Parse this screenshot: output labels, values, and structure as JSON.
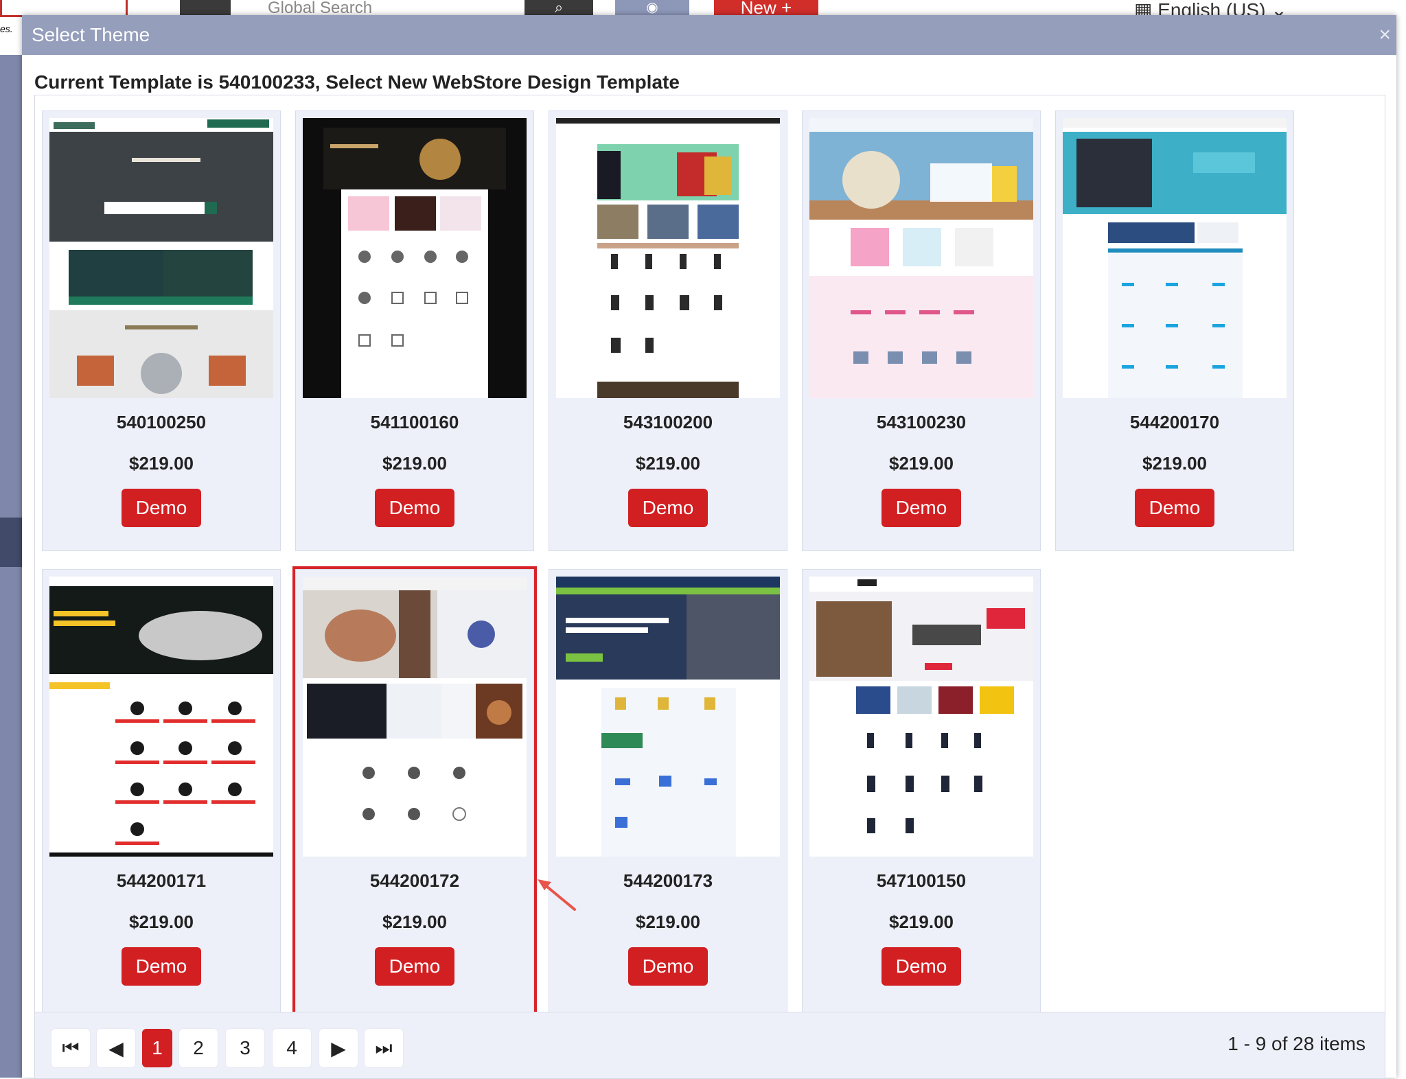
{
  "background": {
    "search_placeholder": "Global Search",
    "new_label": "New +",
    "language": "English (US)",
    "side_text": "es."
  },
  "modal": {
    "title": "Select Theme",
    "close_glyph": "×",
    "subtitle": "Current Template is 540100233, Select New WebStore Design Template"
  },
  "templates": [
    {
      "code": "540100250",
      "price": "$219.00",
      "demo_label": "Demo",
      "selected": false
    },
    {
      "code": "541100160",
      "price": "$219.00",
      "demo_label": "Demo",
      "selected": false
    },
    {
      "code": "543100200",
      "price": "$219.00",
      "demo_label": "Demo",
      "selected": false
    },
    {
      "code": "543100230",
      "price": "$219.00",
      "demo_label": "Demo",
      "selected": false
    },
    {
      "code": "544200170",
      "price": "$219.00",
      "demo_label": "Demo",
      "selected": false
    },
    {
      "code": "544200171",
      "price": "$219.00",
      "demo_label": "Demo",
      "selected": false
    },
    {
      "code": "544200172",
      "price": "$219.00",
      "demo_label": "Demo",
      "selected": true
    },
    {
      "code": "544200173",
      "price": "$219.00",
      "demo_label": "Demo",
      "selected": false
    },
    {
      "code": "547100150",
      "price": "$219.00",
      "demo_label": "Demo",
      "selected": false
    }
  ],
  "pager": {
    "pages": [
      "1",
      "2",
      "3",
      "4"
    ],
    "current": "1",
    "info": "1 - 9 of 28 items"
  },
  "colors": {
    "accent": "#d21f22",
    "header": "#959ebb",
    "card_bg": "#edf0f9"
  }
}
